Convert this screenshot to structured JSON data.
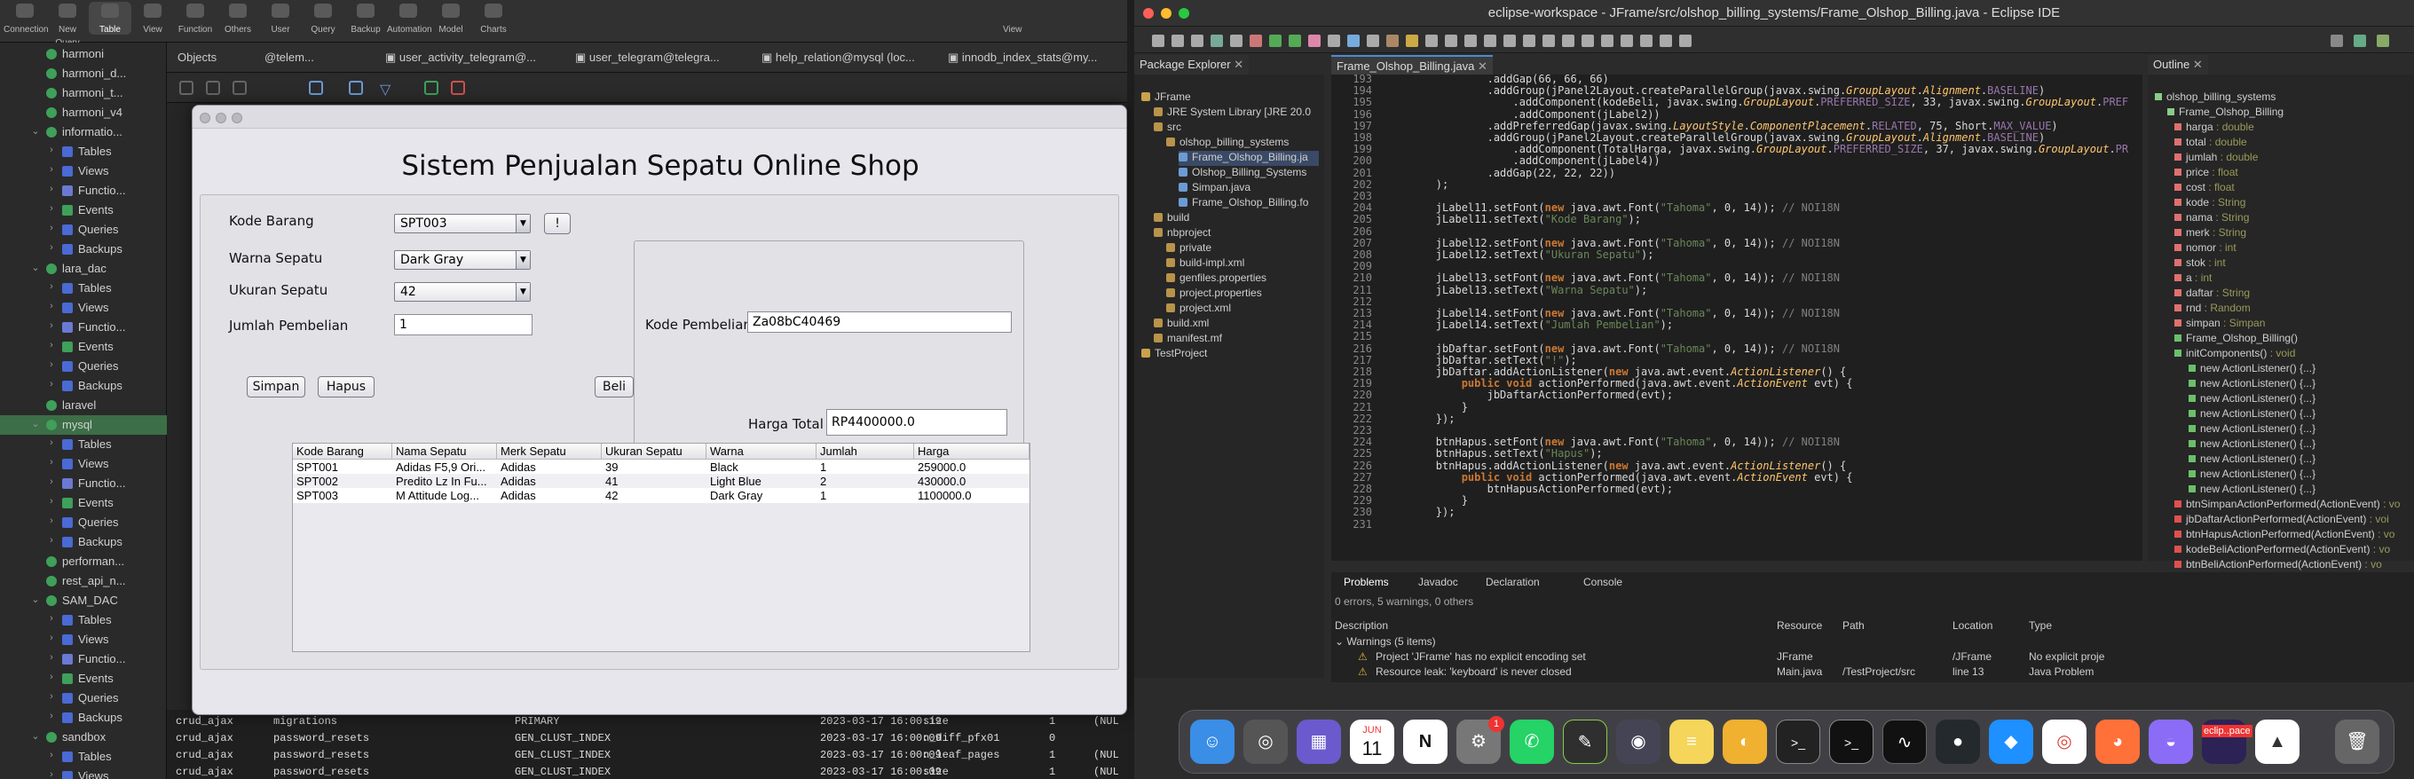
{
  "db_app": {
    "toolbar": [
      "Connection",
      "New Query",
      "Table",
      "View",
      "Function",
      "Others",
      "User",
      "Query",
      "Backup",
      "Automation",
      "Model",
      "Charts"
    ],
    "toolbar_right": "View",
    "sidebar": [
      {
        "label": "harmoni",
        "type": "db"
      },
      {
        "label": "harmoni_d...",
        "type": "db"
      },
      {
        "label": "harmoni_t...",
        "type": "db"
      },
      {
        "label": "harmoni_v4",
        "type": "db"
      },
      {
        "label": "informatio...",
        "type": "db-open"
      },
      {
        "label": "Tables",
        "type": "folder"
      },
      {
        "label": "Views",
        "type": "folder"
      },
      {
        "label": "Functio...",
        "type": "folder"
      },
      {
        "label": "Events",
        "type": "folder"
      },
      {
        "label": "Queries",
        "type": "folder"
      },
      {
        "label": "Backups",
        "type": "folder"
      },
      {
        "label": "lara_dac",
        "type": "db-open"
      },
      {
        "label": "Tables",
        "type": "folder"
      },
      {
        "label": "Views",
        "type": "folder"
      },
      {
        "label": "Functio...",
        "type": "folder"
      },
      {
        "label": "Events",
        "type": "folder"
      },
      {
        "label": "Queries",
        "type": "folder"
      },
      {
        "label": "Backups",
        "type": "folder"
      },
      {
        "label": "laravel",
        "type": "db"
      },
      {
        "label": "mysql",
        "type": "db-sel"
      },
      {
        "label": "Tables",
        "type": "folder"
      },
      {
        "label": "Views",
        "type": "folder"
      },
      {
        "label": "Functio...",
        "type": "folder"
      },
      {
        "label": "Events",
        "type": "folder"
      },
      {
        "label": "Queries",
        "type": "folder"
      },
      {
        "label": "Backups",
        "type": "folder"
      },
      {
        "label": "performan...",
        "type": "db"
      },
      {
        "label": "rest_api_n...",
        "type": "db"
      },
      {
        "label": "SAM_DAC",
        "type": "db-open"
      },
      {
        "label": "Tables",
        "type": "folder"
      },
      {
        "label": "Views",
        "type": "folder"
      },
      {
        "label": "Functio...",
        "type": "folder"
      },
      {
        "label": "Events",
        "type": "folder"
      },
      {
        "label": "Queries",
        "type": "folder"
      },
      {
        "label": "Backups",
        "type": "folder"
      },
      {
        "label": "sandbox",
        "type": "db-open"
      },
      {
        "label": "Tables",
        "type": "folder"
      },
      {
        "label": "Views",
        "type": "folder"
      }
    ],
    "tabs": [
      "Objects",
      "@telem...",
      "user_activity_telegram@...",
      "user_telegram@telegra...",
      "help_relation@mysql (loc...",
      "innodb_index_stats@my..."
    ],
    "rows": [
      [
        "crud_ajax",
        "migrations",
        "PRIMARY",
        "2023-03-17 16:00:19",
        "size",
        "1",
        "(NUL"
      ],
      [
        "crud_ajax",
        "password_resets",
        "GEN_CLUST_INDEX",
        "2023-03-17 16:00:09",
        "n_diff_pfx01",
        "0",
        ""
      ],
      [
        "crud_ajax",
        "password_resets",
        "GEN_CLUST_INDEX",
        "2023-03-17 16:00:09",
        "n_leaf_pages",
        "1",
        "(NUL"
      ],
      [
        "crud_ajax",
        "password_resets",
        "GEN_CLUST_INDEX",
        "2023-03-17 16:00:09",
        "size",
        "1",
        "(NUL"
      ]
    ]
  },
  "java_app": {
    "title": "Sistem Penjualan Sepatu Online Shop",
    "labels": {
      "kode": "Kode Barang",
      "warna": "Warna Sepatu",
      "ukuran": "Ukuran Sepatu",
      "jumlah": "Jumlah Pembelian",
      "kode_pembelian": "Kode Pembelian",
      "harga_total": "Harga Total"
    },
    "values": {
      "kode": "SPT003",
      "warna": "Dark Gray",
      "ukuran": "42",
      "jumlah": "1",
      "kode_pembelian": "Za08bC40469",
      "harga_total": "RP4400000.0"
    },
    "buttons": {
      "excl": "!",
      "simpan": "Simpan",
      "hapus": "Hapus",
      "beli": "Beli"
    },
    "table": {
      "headers": [
        "Kode Barang",
        "Nama Sepatu",
        "Merk Sepatu",
        "Ukuran Sepatu",
        "Warna",
        "Jumlah",
        "Harga"
      ],
      "rows": [
        [
          "SPT001",
          "Adidas F5,9 Ori...",
          "Adidas",
          "39",
          "Black",
          "1",
          "259000.0"
        ],
        [
          "SPT002",
          "Predito Lz In Fu...",
          "Adidas",
          "41",
          "Light Blue",
          "2",
          "430000.0"
        ],
        [
          "SPT003",
          "M Attitude Log...",
          "Adidas",
          "42",
          "Dark Gray",
          "1",
          "1100000.0"
        ]
      ]
    }
  },
  "eclipse": {
    "title": "eclipse-workspace - JFrame/src/olshop_billing_systems/Frame_Olshop_Billing.java - Eclipse IDE",
    "views": {
      "pkg": "Package Explorer",
      "editor_tab": "Frame_Olshop_Billing.java",
      "outline": "Outline"
    },
    "pkg_tree": [
      {
        "t": "JFrame",
        "d": 0
      },
      {
        "t": "JRE System Library [JRE 20.0",
        "d": 1
      },
      {
        "t": "src",
        "d": 1
      },
      {
        "t": "olshop_billing_systems",
        "d": 2
      },
      {
        "t": "Frame_Olshop_Billing.ja",
        "d": 3
      },
      {
        "t": "Olshop_Billing_Systems",
        "d": 3
      },
      {
        "t": "Simpan.java",
        "d": 3
      },
      {
        "t": "Frame_Olshop_Billing.fo",
        "d": 3
      },
      {
        "t": "build",
        "d": 1
      },
      {
        "t": "nbproject",
        "d": 1
      },
      {
        "t": "private",
        "d": 2
      },
      {
        "t": "build-impl.xml",
        "d": 2
      },
      {
        "t": "genfiles.properties",
        "d": 2
      },
      {
        "t": "project.properties",
        "d": 2
      },
      {
        "t": "project.xml",
        "d": 2
      },
      {
        "t": "build.xml",
        "d": 1
      },
      {
        "t": "manifest.mf",
        "d": 1
      },
      {
        "t": "TestProject",
        "d": 0
      }
    ],
    "code": [
      {
        "n": "193",
        "c": "                .addGap(66, 66, 66)"
      },
      {
        "n": "194",
        "c": "                .addGroup(jPanel2Layout.createParallelGroup(javax.swing.GroupLayout.Alignment.BASELINE)"
      },
      {
        "n": "195",
        "c": "                    .addComponent(kodeBeli, javax.swing.GroupLayout.PREFERRED_SIZE, 33, javax.swing.GroupLayout.PREF"
      },
      {
        "n": "196",
        "c": "                    .addComponent(jLabel2))"
      },
      {
        "n": "197",
        "c": "                .addPreferredGap(javax.swing.LayoutStyle.ComponentPlacement.RELATED, 75, Short.MAX_VALUE)"
      },
      {
        "n": "198",
        "c": "                .addGroup(jPanel2Layout.createParallelGroup(javax.swing.GroupLayout.Alignment.BASELINE)"
      },
      {
        "n": "199",
        "c": "                    .addComponent(TotalHarga, javax.swing.GroupLayout.PREFERRED_SIZE, 37, javax.swing.GroupLayout.PR"
      },
      {
        "n": "200",
        "c": "                    .addComponent(jLabel4))"
      },
      {
        "n": "201",
        "c": "                .addGap(22, 22, 22))"
      },
      {
        "n": "202",
        "c": "        );"
      },
      {
        "n": "203",
        "c": ""
      },
      {
        "n": "204",
        "c": "        jLabel11.setFont(new java.awt.Font(\"Tahoma\", 0, 14)); // NOI18N"
      },
      {
        "n": "205",
        "c": "        jLabel11.setText(\"Kode Barang\");"
      },
      {
        "n": "206",
        "c": ""
      },
      {
        "n": "207",
        "c": "        jLabel12.setFont(new java.awt.Font(\"Tahoma\", 0, 14)); // NOI18N"
      },
      {
        "n": "208",
        "c": "        jLabel12.setText(\"Ukuran Sepatu\");"
      },
      {
        "n": "209",
        "c": ""
      },
      {
        "n": "210",
        "c": "        jLabel13.setFont(new java.awt.Font(\"Tahoma\", 0, 14)); // NOI18N"
      },
      {
        "n": "211",
        "c": "        jLabel13.setText(\"Warna Sepatu\");"
      },
      {
        "n": "212",
        "c": ""
      },
      {
        "n": "213",
        "c": "        jLabel14.setFont(new java.awt.Font(\"Tahoma\", 0, 14)); // NOI18N"
      },
      {
        "n": "214",
        "c": "        jLabel14.setText(\"Jumlah Pembelian\");"
      },
      {
        "n": "215",
        "c": ""
      },
      {
        "n": "216",
        "c": "        jbDaftar.setFont(new java.awt.Font(\"Tahoma\", 0, 14)); // NOI18N"
      },
      {
        "n": "217",
        "c": "        jbDaftar.setText(\"!\");"
      },
      {
        "n": "218",
        "c": "        jbDaftar.addActionListener(new java.awt.event.ActionListener() {"
      },
      {
        "n": "219",
        "c": "            public void actionPerformed(java.awt.event.ActionEvent evt) {"
      },
      {
        "n": "220",
        "c": "                jbDaftarActionPerformed(evt);"
      },
      {
        "n": "221",
        "c": "            }"
      },
      {
        "n": "222",
        "c": "        });"
      },
      {
        "n": "223",
        "c": ""
      },
      {
        "n": "224",
        "c": "        btnHapus.setFont(new java.awt.Font(\"Tahoma\", 0, 14)); // NOI18N"
      },
      {
        "n": "225",
        "c": "        btnHapus.setText(\"Hapus\");"
      },
      {
        "n": "226",
        "c": "        btnHapus.addActionListener(new java.awt.event.ActionListener() {"
      },
      {
        "n": "227",
        "c": "            public void actionPerformed(java.awt.event.ActionEvent evt) {"
      },
      {
        "n": "228",
        "c": "                btnHapusActionPerformed(evt);"
      },
      {
        "n": "229",
        "c": "            }"
      },
      {
        "n": "230",
        "c": "        });"
      },
      {
        "n": "231",
        "c": ""
      }
    ],
    "outline": [
      {
        "t": "olshop_billing_systems",
        "ty": "",
        "c": "#8c8"
      },
      {
        "t": "Frame_Olshop_Billing",
        "ty": "",
        "c": "#8c8"
      },
      {
        "t": "harga",
        "ty": " : double",
        "c": "#e07070"
      },
      {
        "t": "total",
        "ty": " : double",
        "c": "#e07070"
      },
      {
        "t": "jumlah",
        "ty": " : double",
        "c": "#e07070"
      },
      {
        "t": "price",
        "ty": " : float",
        "c": "#e07070"
      },
      {
        "t": "cost",
        "ty": " : float",
        "c": "#e07070"
      },
      {
        "t": "kode",
        "ty": " : String",
        "c": "#e07070"
      },
      {
        "t": "nama",
        "ty": " : String",
        "c": "#e07070"
      },
      {
        "t": "merk",
        "ty": " : String",
        "c": "#e07070"
      },
      {
        "t": "nomor",
        "ty": " : int",
        "c": "#e07070"
      },
      {
        "t": "stok",
        "ty": " : int",
        "c": "#e07070"
      },
      {
        "t": "a",
        "ty": " : int",
        "c": "#e07070"
      },
      {
        "t": "daftar",
        "ty": " : String",
        "c": "#e07070"
      },
      {
        "t": "rnd",
        "ty": " : Random",
        "c": "#e07070"
      },
      {
        "t": "simpan",
        "ty": " : Simpan",
        "c": "#e07070"
      },
      {
        "t": "Frame_Olshop_Billing()",
        "ty": "",
        "c": "#6bbf6b"
      },
      {
        "t": "initComponents()",
        "ty": " : void",
        "c": "#6bbf6b"
      },
      {
        "t": "new ActionListener() {...}",
        "ty": "",
        "c": "#6bbf6b"
      },
      {
        "t": "new ActionListener() {...}",
        "ty": "",
        "c": "#6bbf6b"
      },
      {
        "t": "new ActionListener() {...}",
        "ty": "",
        "c": "#6bbf6b"
      },
      {
        "t": "new ActionListener() {...}",
        "ty": "",
        "c": "#6bbf6b"
      },
      {
        "t": "new ActionListener() {...}",
        "ty": "",
        "c": "#6bbf6b"
      },
      {
        "t": "new ActionListener() {...}",
        "ty": "",
        "c": "#6bbf6b"
      },
      {
        "t": "new ActionListener() {...}",
        "ty": "",
        "c": "#6bbf6b"
      },
      {
        "t": "new ActionListener() {...}",
        "ty": "",
        "c": "#6bbf6b"
      },
      {
        "t": "new ActionListener() {...}",
        "ty": "",
        "c": "#6bbf6b"
      },
      {
        "t": "btnSimpanActionPerformed(ActionEvent)",
        "ty": " : vo",
        "c": "#e05050"
      },
      {
        "t": "jbDaftarActionPerformed(ActionEvent)",
        "ty": " : voi",
        "c": "#e05050"
      },
      {
        "t": "btnHapusActionPerformed(ActionEvent)",
        "ty": " : vo",
        "c": "#e05050"
      },
      {
        "t": "kodeBeliActionPerformed(ActionEvent)",
        "ty": " : vo",
        "c": "#e05050"
      },
      {
        "t": "btnBeliActionPerformed(ActionEvent)",
        "ty": " : vo",
        "c": "#e05050"
      }
    ],
    "bottom_tabs": [
      "Problems",
      "Javadoc",
      "Declaration",
      "Console"
    ],
    "problem_summary": "0 errors, 5 warnings, 0 others",
    "problem_headers": [
      "Description",
      "Resource",
      "Path",
      "Location",
      "Type"
    ],
    "problem_group": "Warnings (5 items)",
    "problems": [
      [
        "Project 'JFrame' has no explicit encoding set",
        "JFrame",
        "",
        "/JFrame",
        "No explicit proje"
      ],
      [
        "Resource leak: 'keyboard' is never closed",
        "Main.java",
        "/TestProject/src",
        "line 13",
        "Java Problem"
      ]
    ]
  },
  "dock": {
    "date_month": "JUN",
    "date_day": "11",
    "mail_badge": "1",
    "eclipse_label": "eclip..pace"
  }
}
